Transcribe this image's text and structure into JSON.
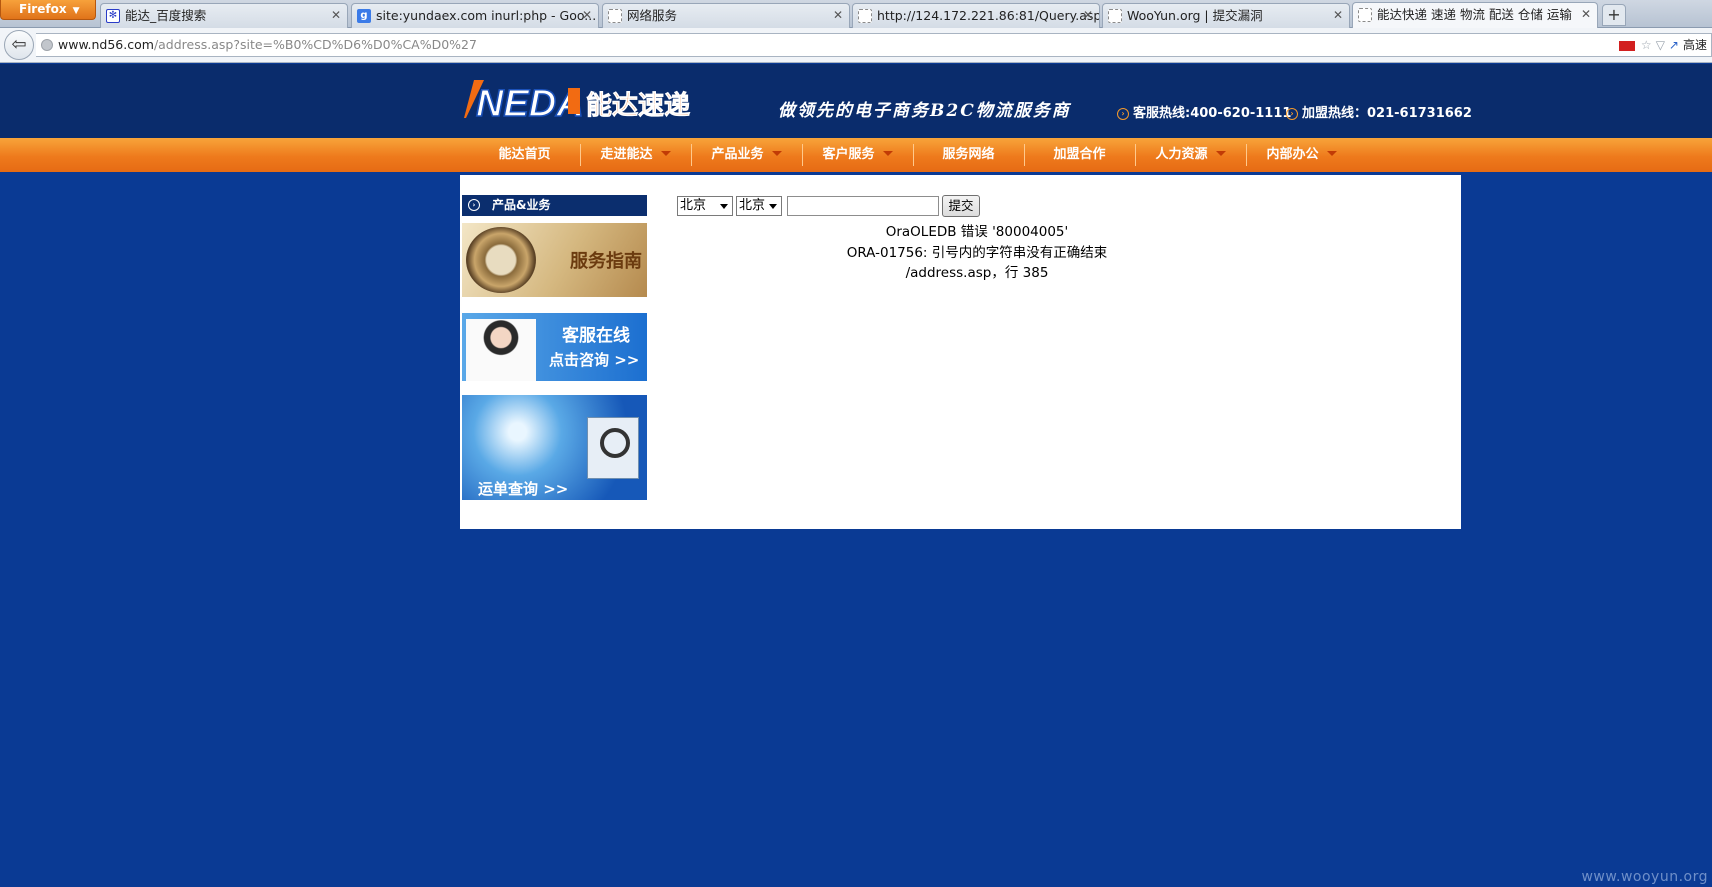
{
  "browser": {
    "menu_button": "Firefox",
    "tabs": [
      {
        "title": "能达_百度搜索",
        "favicon": "baidu-paw"
      },
      {
        "title": "site:yundaex.com inurl:php - Goo...",
        "favicon": "google-g"
      },
      {
        "title": "网络服务",
        "favicon": "blank-page"
      },
      {
        "title": "http://124.172.221.86:81/Query.asp",
        "favicon": "blank-page"
      },
      {
        "title": "WooYun.org | 提交漏洞",
        "favicon": "blank-page"
      },
      {
        "title": "能达快递 速递 物流 配送 仓储 运输",
        "favicon": "blank-page",
        "active": true
      }
    ],
    "new_tab_symbol": "+",
    "url_host": "www.nd56.com",
    "url_path": "/address.asp?site=%B0%CD%D6%D0%CA%D0%27",
    "search_engine_label": "高速"
  },
  "header": {
    "logo_text": "NEDA",
    "logo_cn": "能达速递",
    "slogan": "做领先的电子商务B2C物流服务商",
    "hotline_service": "客服热线:400-620-1111",
    "hotline_franchise": "加盟热线：021-61731662"
  },
  "menu": [
    {
      "label": "能达首页",
      "has_dropdown": false
    },
    {
      "label": "走进能达",
      "has_dropdown": true
    },
    {
      "label": "产品业务",
      "has_dropdown": true
    },
    {
      "label": "客户服务",
      "has_dropdown": true
    },
    {
      "label": "服务网络",
      "has_dropdown": false
    },
    {
      "label": "加盟合作",
      "has_dropdown": false
    },
    {
      "label": "人力资源",
      "has_dropdown": true
    },
    {
      "label": "内部办公",
      "has_dropdown": true
    }
  ],
  "sidebar": {
    "title": "产品&业务",
    "banners": [
      {
        "text": "服务指南"
      },
      {
        "line1": "客服在线",
        "line2": "点击咨询 >>"
      },
      {
        "text": "运单查询 >>"
      }
    ]
  },
  "query_form": {
    "province": "北京",
    "city": "北京",
    "input_value": "",
    "submit_label": "提交"
  },
  "error": {
    "line1": "OraOLEDB 错误 '80004005'",
    "line2": "ORA-01756: 引号内的字符串没有正确结束",
    "line3": "/address.asp，行 385"
  },
  "watermark": "www.wooyun.org",
  "colors": {
    "page_bg": "#0a3a94",
    "header_bg": "#0a2c6c",
    "menu_orange": "#ee7a1c",
    "logo_orange": "#f26b12"
  }
}
